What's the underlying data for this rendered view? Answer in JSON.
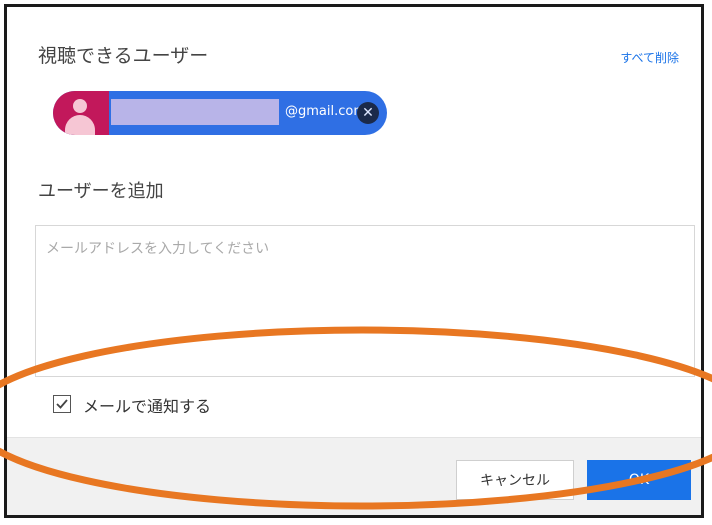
{
  "dialog": {
    "title": "視聴できるユーザー",
    "remove_all_label": "すべて削除",
    "user_chip": {
      "email_suffix": "@gmail.com",
      "avatar_icon": "person-icon",
      "remove_icon": "close-icon"
    },
    "add_user_label": "ユーザーを追加",
    "email_input": {
      "value": "",
      "placeholder": "メールアドレスを入力してください"
    },
    "notify": {
      "label": "メールで通知する",
      "checked": true
    },
    "buttons": {
      "cancel": "キャンセル",
      "ok": "OK"
    }
  },
  "annotation": {
    "shape": "ellipse",
    "color": "#e87722"
  },
  "colors": {
    "accent": "#1a73e8",
    "chip": "#2f6fe4",
    "avatar": "#c2185b"
  }
}
